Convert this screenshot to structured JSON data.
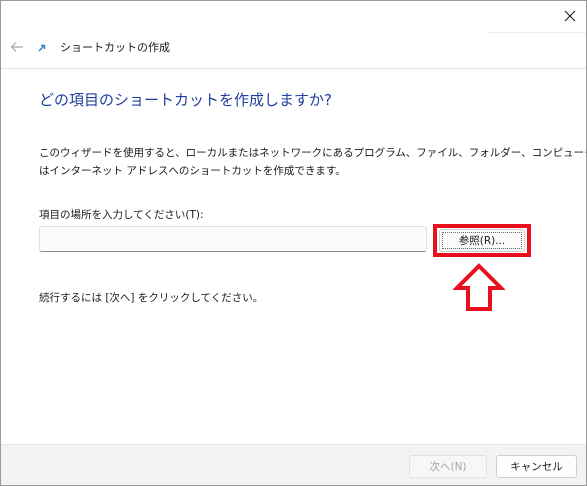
{
  "wizard": {
    "title": "ショートカットの作成"
  },
  "main": {
    "heading": "どの項目のショートカットを作成しますか?",
    "description_lines": [
      "このウィザードを使用すると、ローカルまたはネットワークにあるプログラム、ファイル、フォルダー、コンピューター、また",
      "はインターネット アドレスへのショートカットを作成できます。"
    ],
    "location_label": "項目の場所を入力してください(T):",
    "location_value": "",
    "browse_label": "参照(R)...",
    "continue_text": "続行するには [次へ] をクリックしてください。"
  },
  "footer": {
    "next_label": "次へ(N)",
    "next_disabled": true,
    "cancel_label": "キャンセル"
  },
  "icons": {
    "close": "close-icon",
    "back": "back-arrow-icon",
    "wizard": "shortcut-arrow-icon",
    "annotation": "up-arrow-annotation"
  },
  "colors": {
    "heading": "#1f3f9e",
    "highlight": "#e8101e",
    "footer_bg": "#f3f3f3",
    "disabled_text": "#a4a4a4"
  }
}
